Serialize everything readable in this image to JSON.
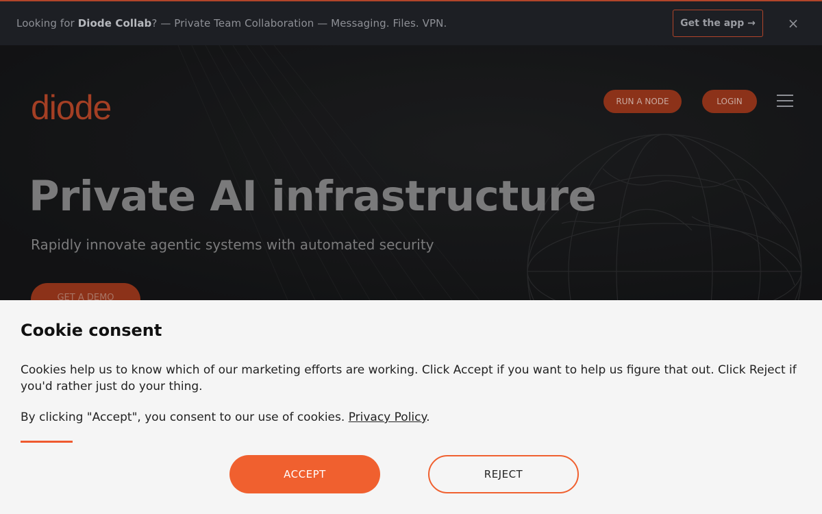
{
  "topbar": {
    "prefix": "Looking for ",
    "product": "Diode Collab",
    "suffix": "? — Private Team Collaboration — Messaging. Files. VPN.",
    "cta_label": "Get the app →",
    "close_glyph": "×"
  },
  "header": {
    "logo": "diode",
    "run_node_label": "RUN A NODE",
    "login_label": "LOGIN"
  },
  "hero": {
    "title": "Private AI infrastructure",
    "subtitle": "Rapidly innovate agentic systems with automated security",
    "cta_label": "GET A DEMO"
  },
  "cookie": {
    "title": "Cookie consent",
    "body": "Cookies help us to know which of our marketing efforts are working. Click Accept if you want to help us figure that out. Click Reject if you'd rather just do your thing.",
    "consent_prefix": "By clicking \"Accept\", you consent to our use of cookies. ",
    "policy_link": "Privacy Policy",
    "consent_suffix": ".",
    "accept_label": "ACCEPT",
    "reject_label": "REJECT"
  },
  "colors": {
    "accent": "#f0602f",
    "brand_dark": "#a43f24",
    "hero_bg": "#1b1c1e"
  }
}
